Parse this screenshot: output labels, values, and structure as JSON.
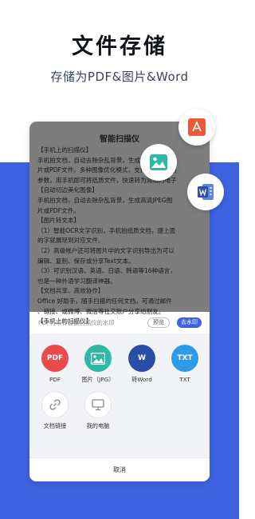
{
  "header": {
    "title": "文件存储",
    "subtitle": "存储为PDF&图片&Word"
  },
  "document": {
    "title": "智能扫描仪",
    "lines": [
      "【手机上的扫描仪】",
      "手机拍文档，自动去除杂乱背景，生成高清JPEG图",
      "片或PDF文件。多种图像优化模式，支持自动调节图",
      "参数，用手机即可将纸质文件，快速转为清晰的电子",
      "【自动切边美化图像】",
      "手机拍文档，自动去除杂乱背景，生成高清JPEG图",
      "片或PDF文件。",
      "【图片转文本】",
      "（1）智能OCR文字识别，手机拍纸质文档，提上面",
      "的字就展现到对应文件。",
      "（2）高级帐户还可将图片中的文字识别导出为可以",
      "编辑、复制、保存或分享Text文本。",
      "（3）可识别汉语、英语、日语、韩语等16种语言，",
      "也是一种外语学习翻译神器。",
      "【文档共享、高效协作】",
      "Office 好助手，随手扫描的任何文档，可通过邮件",
      "、链接、或微博、微信等社交账户分享给朋友。",
      "【手机上的扫描仪】"
    ]
  },
  "watermark": {
    "text": "PDF将带有智能扫描仪的水印",
    "preview_label": "预览",
    "remove_label": "去水印"
  },
  "share": {
    "items": [
      {
        "icon_text": "PDF",
        "label": "PDF",
        "icon": "pdf-icon"
      },
      {
        "icon_text": "",
        "label": "图片（JPG）",
        "icon": "image-icon"
      },
      {
        "icon_text": "W",
        "label": "转Word",
        "icon": "word-icon"
      },
      {
        "icon_text": "TXT",
        "label": "TXT",
        "icon": "txt-icon"
      },
      {
        "icon_text": "",
        "label": "文档链接",
        "icon": "link-icon"
      },
      {
        "icon_text": "",
        "label": "我的电脑",
        "icon": "computer-icon"
      }
    ],
    "cancel_label": "取消"
  },
  "colors": {
    "accent": "#3f62e0",
    "pdf": "#e94b4b",
    "image": "#2fb8a3",
    "word": "#2b4fa8",
    "txt": "#2d9be8"
  }
}
